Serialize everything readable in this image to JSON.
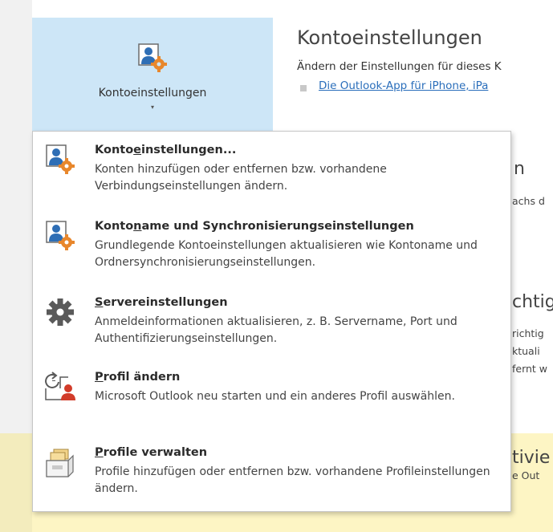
{
  "account_settings_button": {
    "label": "Kontoeinstellungen",
    "icon": "account-settings-icon",
    "caret": "▾"
  },
  "right_panel": {
    "title": "Kontoeinstellungen",
    "description": "Ändern der Einstellungen für dieses K",
    "link": "Die Outlook-App für iPhone, iPa"
  },
  "partial_text": {
    "section_heading_1": "n",
    "line_1": "achs d",
    "section_heading_2": "chtig",
    "line_2a": "richtig",
    "line_2b": "ktuali",
    "line_2c": "fernt w",
    "section_heading_3": "tivie",
    "line_3": "e Out"
  },
  "menu": {
    "items": [
      {
        "title_pre": "Konto",
        "title_accel": "e",
        "title_post": "instellungen...",
        "description": "Konten hinzufügen oder entfernen bzw. vorhandene Verbindungseinstellungen ändern.",
        "icon": "account-settings-icon"
      },
      {
        "title_pre": "Konto",
        "title_accel": "n",
        "title_post": "ame und Synchronisierungseinstellungen",
        "description": "Grundlegende Kontoeinstellungen aktualisieren wie Kontoname und Ordnersynchronisierungseinstellungen.",
        "icon": "account-name-sync-icon"
      },
      {
        "title_pre": "",
        "title_accel": "S",
        "title_post": "ervereinstellungen",
        "description": "Anmeldeinformationen aktualisieren, z. B. Servername, Port und Authentifizierungseinstellungen.",
        "icon": "gear-icon"
      },
      {
        "title_pre": "",
        "title_accel": "P",
        "title_post": "rofil ändern",
        "description": "Microsoft Outlook neu starten und ein anderes Profil auswählen.",
        "icon": "change-profile-icon"
      },
      {
        "title_pre": "",
        "title_accel": "P",
        "title_post": "rofile verwalten",
        "description": "Profile hinzufügen oder entfernen bzw. vorhandene Profileinstellungen ändern.",
        "icon": "manage-profiles-icon"
      }
    ]
  },
  "colors": {
    "button_bg": "#cde6f7",
    "link": "#2a6ebb",
    "icon_blue": "#2e6eb5",
    "icon_orange": "#e8872c",
    "highlight_band": "#fdf5c4"
  }
}
